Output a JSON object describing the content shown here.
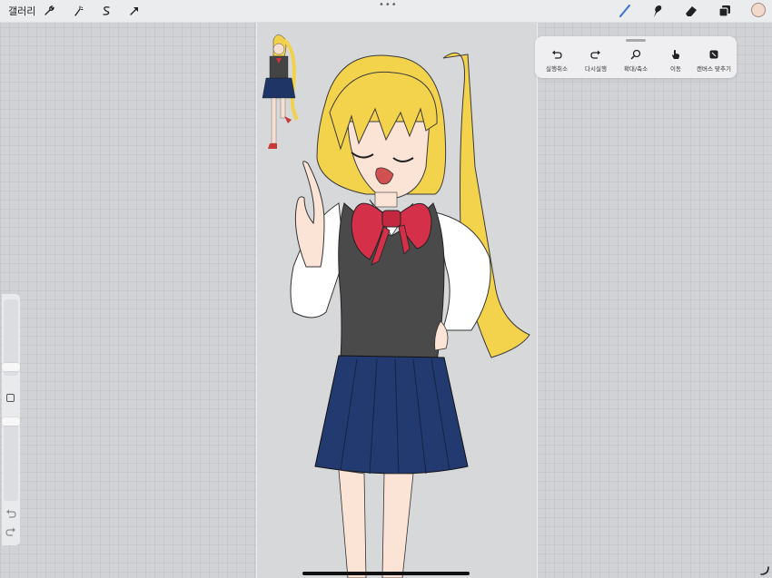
{
  "topbar": {
    "gallery_label": "갤러리",
    "left_tools": [
      "wrench-icon",
      "magic-wand-icon",
      "selection-icon",
      "transform-arrow-icon"
    ],
    "right_tools": [
      "brush-icon",
      "smudge-icon",
      "eraser-icon",
      "layers-icon"
    ],
    "accent_color": "#3a6fd8",
    "current_color": "#f2d9cc"
  },
  "quick_menu": {
    "items": [
      {
        "icon": "undo-icon",
        "label": "실행취소"
      },
      {
        "icon": "redo-icon",
        "label": "다시실행"
      },
      {
        "icon": "zoom-icon",
        "label": "확대/축소"
      },
      {
        "icon": "hand-icon",
        "label": "이동"
      },
      {
        "icon": "fit-canvas-icon",
        "label": "캔버스 맞추기"
      }
    ]
  },
  "sidebar": {
    "brush_size_level": 0.3,
    "opacity_level": 0.95
  },
  "canvas": {
    "artwork": "anime-girl-drawing"
  }
}
